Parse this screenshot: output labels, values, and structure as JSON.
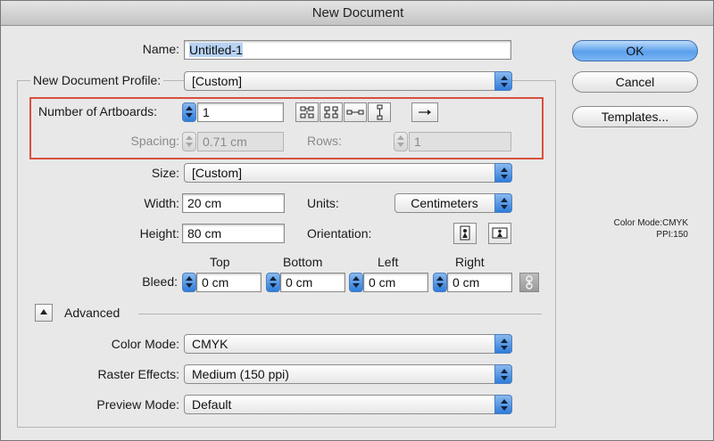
{
  "window": {
    "title": "New Document"
  },
  "name": {
    "label": "Name:",
    "value": "Untitled-1"
  },
  "profile": {
    "label": "New Document Profile:",
    "value": "[Custom]"
  },
  "artboards": {
    "label": "Number of Artboards:",
    "value": "1",
    "spacing_label": "Spacing:",
    "spacing_value": "0.71 cm",
    "rows_label": "Rows:",
    "rows_value": "1",
    "layout_icons": [
      "grid-by-row-icon",
      "grid-by-column-icon",
      "arrange-by-row-icon",
      "arrange-by-column-icon"
    ],
    "direction_icon": "right-to-left-layout-icon"
  },
  "size": {
    "label": "Size:",
    "value": "[Custom]"
  },
  "width": {
    "label": "Width:",
    "value": "20 cm"
  },
  "height": {
    "label": "Height:",
    "value": "80 cm"
  },
  "units": {
    "label": "Units:",
    "value": "Centimeters"
  },
  "orientation": {
    "label": "Orientation:",
    "portrait_icon": "portrait-orientation-icon",
    "landscape_icon": "landscape-orientation-icon"
  },
  "bleed": {
    "label": "Bleed:",
    "top_label": "Top",
    "top_value": "0 cm",
    "bottom_label": "Bottom",
    "bottom_value": "0 cm",
    "left_label": "Left",
    "left_value": "0 cm",
    "right_label": "Right",
    "right_value": "0 cm",
    "link_icon": "link-bleed-icon"
  },
  "advanced": {
    "label": "Advanced"
  },
  "color_mode": {
    "label": "Color Mode:",
    "value": "CMYK"
  },
  "raster_effects": {
    "label": "Raster Effects:",
    "value": "Medium (150 ppi)"
  },
  "preview_mode": {
    "label": "Preview Mode:",
    "value": "Default"
  },
  "buttons": {
    "ok": "OK",
    "cancel": "Cancel",
    "templates": "Templates..."
  },
  "info": {
    "color_mode": "Color Mode:CMYK",
    "ppi": "PPI:150"
  },
  "colors": {
    "accent": "#2f7ddb",
    "highlight": "#d9503f"
  }
}
